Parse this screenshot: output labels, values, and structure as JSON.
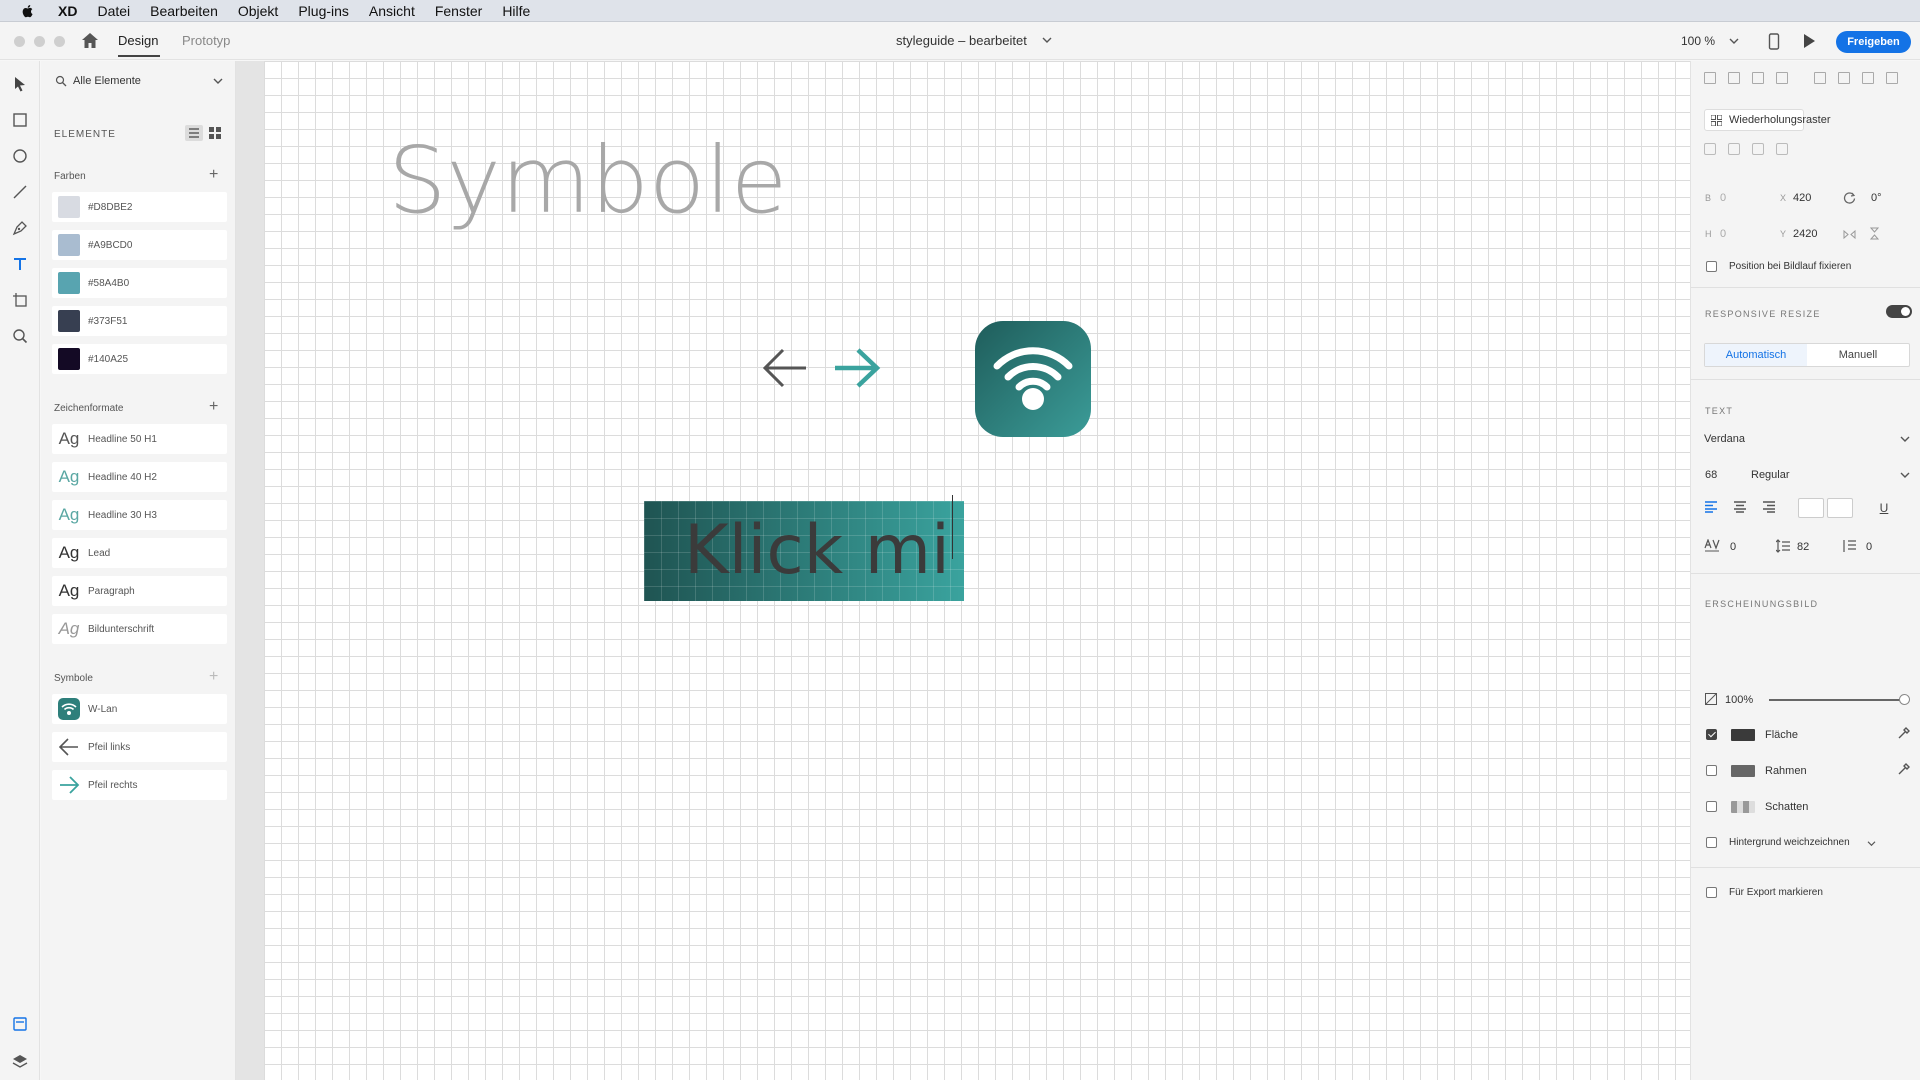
{
  "menubar": {
    "app": "XD",
    "items": [
      "Datei",
      "Bearbeiten",
      "Objekt",
      "Plug-ins",
      "Ansicht",
      "Fenster",
      "Hilfe"
    ]
  },
  "toolbar": {
    "tabs": [
      "Design",
      "Prototyp"
    ],
    "active_tab": "Design",
    "document_title": "styleguide – bearbeitet",
    "zoom": "100 %",
    "share_label": "Freigeben",
    "accent_color": "#1473e6"
  },
  "assets": {
    "search_label": "Alle Elemente",
    "header": "ELEMENTE",
    "colors_header": "Farben",
    "colors": [
      {
        "label": "#D8DBE2",
        "hex": "#D8DBE2"
      },
      {
        "label": "#A9BCD0",
        "hex": "#A9BCD0"
      },
      {
        "label": "#58A4B0",
        "hex": "#58A4B0"
      },
      {
        "label": "#373F51",
        "hex": "#373F51"
      },
      {
        "label": "#140A25",
        "hex": "#140A25"
      }
    ],
    "char_styles_header": "Zeichenformate",
    "char_styles": [
      {
        "sample": "Ag",
        "label": "Headline 50 H1",
        "color": "#555555"
      },
      {
        "sample": "Ag",
        "label": "Headline 40 H2",
        "color": "#5aa7a3"
      },
      {
        "sample": "Ag",
        "label": "Headline 30 H3",
        "color": "#5aa7a3"
      },
      {
        "sample": "Ag",
        "label": "Lead",
        "color": "#333333"
      },
      {
        "sample": "Ag",
        "label": "Paragraph",
        "color": "#333333"
      },
      {
        "sample": "Ag",
        "label": "Bildunterschrift",
        "color": "#999999"
      }
    ],
    "symbols_header": "Symbole",
    "symbols": [
      {
        "label": "W-Lan",
        "icon": "wifi-icon"
      },
      {
        "label": "Pfeil links",
        "icon": "arrow-left-icon"
      },
      {
        "label": "Pfeil rechts",
        "icon": "arrow-right-icon"
      }
    ]
  },
  "canvas": {
    "heading": "Symbole",
    "button_text": "Klick mi"
  },
  "inspector": {
    "repeat_grid_label": "Wiederholungsraster",
    "transform": {
      "w_label": "B",
      "w": "0",
      "h_label": "H",
      "h": "0",
      "x_label": "X",
      "x": "420",
      "y_label": "Y",
      "y": "2420",
      "rotation": "0°"
    },
    "fix_position_label": "Position bei Bildlauf fixieren",
    "responsive_header": "RESPONSIVE RESIZE",
    "resize_options": [
      "Automatisch",
      "Manuell"
    ],
    "text_header": "TEXT",
    "font_family": "Verdana",
    "font_size": "68",
    "font_weight": "Regular",
    "char_spacing": "0",
    "line_spacing": "82",
    "paragraph_spacing": "0",
    "appearance_header": "ERSCHEINUNGSBILD",
    "opacity": "100%",
    "fill_label": "Fläche",
    "border_label": "Rahmen",
    "shadow_label": "Schatten",
    "bg_blur_label": "Hintergrund weichzeichnen",
    "export_label": "Für Export markieren"
  }
}
